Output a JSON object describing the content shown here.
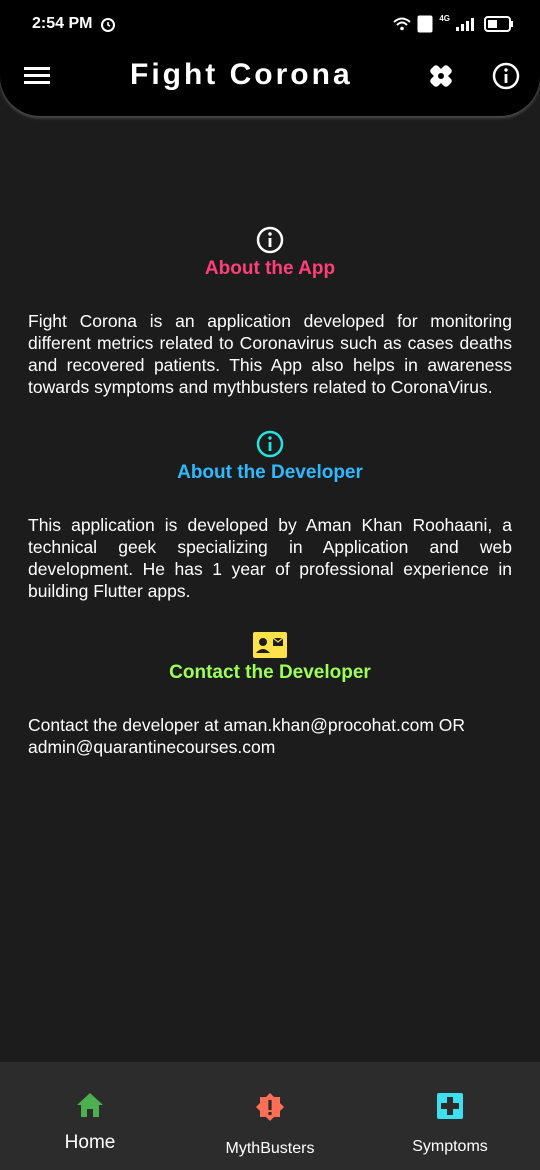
{
  "status": {
    "time": "2:54 PM",
    "network": "4G"
  },
  "appbar": {
    "title": "Fight Corona"
  },
  "sections": [
    {
      "title": "About the App",
      "icon": "info-icon",
      "color": "#ff3f7a",
      "body": "Fight Corona is an application developed for monitoring different metrics related to Coronavirus such as cases deaths and recovered patients. This App also helps in awareness towards symptoms and mythbusters related to CoronaVirus."
    },
    {
      "title": "About the Developer",
      "icon": "info-icon",
      "color": "#2fb9ff",
      "body": "This application is developed by Aman Khan Roohaani, a technical geek specializing in Application and web development. He has 1 year of professional experience in building Flutter apps."
    },
    {
      "title": "Contact the Developer",
      "icon": "contact-card-icon",
      "color": "#9cff55",
      "body": "Contact the developer at aman.khan@procohat.com OR admin@quarantinecourses.com"
    }
  ],
  "bottom_nav": [
    {
      "label": "Home",
      "icon": "home-icon",
      "color": "#4caf50"
    },
    {
      "label": "MythBusters",
      "icon": "alert-badge-icon",
      "color": "#ff6f55"
    },
    {
      "label": "Symptoms",
      "icon": "medical-plus-icon",
      "color": "#3ee0f0"
    }
  ]
}
